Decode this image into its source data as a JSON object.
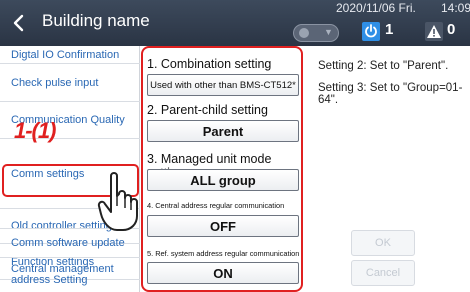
{
  "header": {
    "title": "Building name",
    "date": "2020/11/06 Fri.",
    "time": "14:09",
    "power_count": "1",
    "alert_count": "0"
  },
  "sidebar": {
    "items": [
      {
        "label": "Digtal IO Confirmation"
      },
      {
        "label": "Check pulse input"
      },
      {
        "label": "Communication Quality"
      },
      {
        "label": "Comm settings"
      },
      {
        "label": "Old controller setting"
      },
      {
        "label": "Function settings"
      },
      {
        "label": "Comm software update"
      },
      {
        "label": "Central management address Setting"
      }
    ],
    "step_label": "1-(1)"
  },
  "settings": {
    "combination": {
      "label": "1. Combination setting",
      "value": "Used with other than BMS-CT512*"
    },
    "parent_child": {
      "label": "2. Parent-child setting",
      "value": "Parent"
    },
    "managed_unit": {
      "label": "3. Managed unit mode setting",
      "value": "ALL group"
    },
    "central_address": {
      "label": "4. Central address regular communication",
      "value": "OFF"
    },
    "ref_system": {
      "label": "5. Ref. system address regular communication",
      "value": "ON"
    }
  },
  "info": {
    "line1": "Setting 2: Set to \"Parent\".",
    "line2": "Setting 3: Set to \"Group=01-64\"."
  },
  "actions": {
    "ok": "OK",
    "cancel": "Cancel"
  },
  "colors": {
    "highlight": "#e02020",
    "header": "#2f3a4a",
    "link": "#2a68b4",
    "badge": "#2f8fe6"
  }
}
